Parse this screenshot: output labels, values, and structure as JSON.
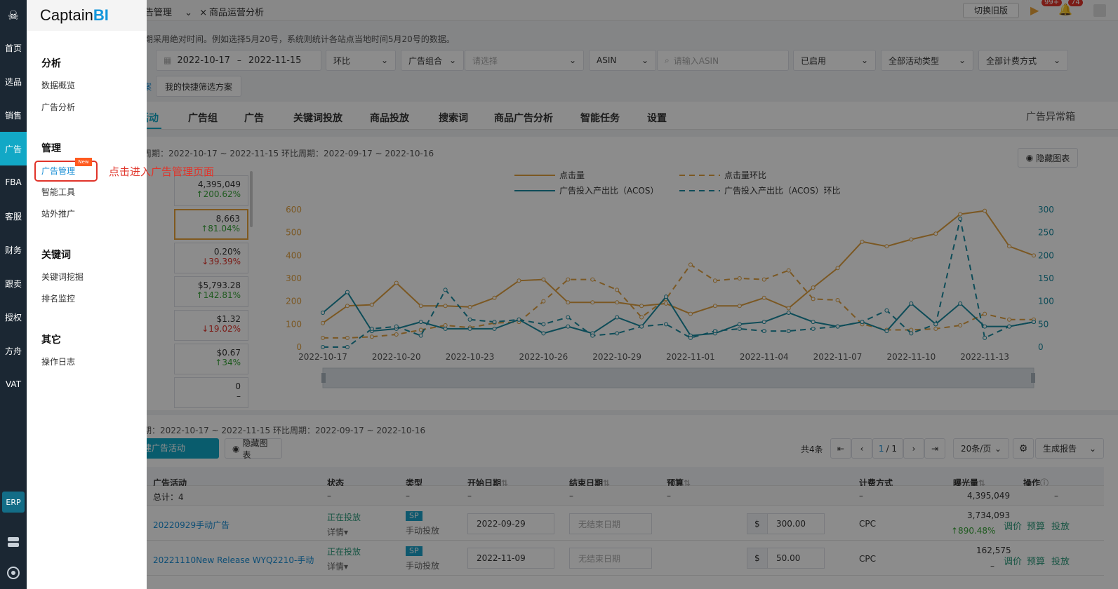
{
  "iconbar": {
    "items": [
      "首页",
      "选品",
      "销售",
      "广告",
      "FBA",
      "客服",
      "财务",
      "跟卖",
      "授权",
      "方舟",
      "VAT"
    ],
    "active": "广告",
    "erp": "ERP"
  },
  "menu": {
    "brand_a": "Captain",
    "brand_b": "BI",
    "sections": [
      {
        "title": "分析",
        "items": [
          "数据概览",
          "广告分析"
        ]
      },
      {
        "title": "管理",
        "items": [
          "广告管理",
          "智能工具",
          "站外推广"
        ]
      },
      {
        "title": "关键词",
        "items": [
          "关键词挖掘",
          "排名监控"
        ]
      },
      {
        "title": "其它",
        "items": [
          "操作日志"
        ]
      }
    ],
    "new_tag": "New",
    "callout": "点击进入广告管理页面"
  },
  "topbar": {
    "tab1": "告管理",
    "tab2": "商品运营分析",
    "switch_old": "切换旧版",
    "badge1": "99+",
    "badge2": "74"
  },
  "notice": "期采用绝对时间。例如选择5月20号，系统则统计各站点当地时间5月20号的数据。",
  "filters": {
    "date_start": "2022-10-17",
    "date_sep": "–",
    "date_end": "2022-11-15",
    "compare": "环比",
    "group": "广告组合",
    "group_ph": "请选择",
    "asin": "ASIN",
    "asin_ph": "请输入ASIN",
    "status": "已启用",
    "activity_type": "全部活动类型",
    "billing": "全部计费方式",
    "quick_left": "案",
    "quick": "我的快捷筛选方案"
  },
  "tabs": [
    "活动",
    "广告组",
    "广告",
    "关键词投放",
    "商品投放",
    "搜索词",
    "商品广告分析",
    "智能任务",
    "设置"
  ],
  "tab_right": "广告异常箱",
  "chart_period": "周期：2022-10-17 ~ 2022-11-15 环比周期：2022-09-17 ~ 2022-10-16",
  "hide_chart": "隐藏图表",
  "metric_cards": [
    {
      "value": "4,395,049",
      "change": "↑200.62%",
      "dir": "up"
    },
    {
      "value": "8,663",
      "change": "↑81.04%",
      "dir": "up"
    },
    {
      "value": "0.20%",
      "change": "↓39.39%",
      "dir": "down"
    },
    {
      "value": "$5,793.28",
      "change": "↑142.81%",
      "dir": "up"
    },
    {
      "value": "$1.32",
      "change": "↓19.02%",
      "dir": "down"
    },
    {
      "value": "$0.67",
      "change": "↑34%",
      "dir": "up"
    },
    {
      "value": "0",
      "change": "–",
      "dir": "none"
    }
  ],
  "chart_data": {
    "type": "line",
    "x": [
      "2022-10-17",
      "2022-10-18",
      "2022-10-19",
      "2022-10-20",
      "2022-10-21",
      "2022-10-22",
      "2022-10-23",
      "2022-10-24",
      "2022-10-25",
      "2022-10-26",
      "2022-10-27",
      "2022-10-28",
      "2022-10-29",
      "2022-10-30",
      "2022-10-31",
      "2022-11-01",
      "2022-11-02",
      "2022-11-03",
      "2022-11-04",
      "2022-11-05",
      "2022-11-06",
      "2022-11-07",
      "2022-11-08",
      "2022-11-09",
      "2022-11-10",
      "2022-11-11",
      "2022-11-12",
      "2022-11-13",
      "2022-11-14",
      "2022-11-15"
    ],
    "xticks": [
      "2022-10-17",
      "2022-10-20",
      "2022-10-23",
      "2022-10-26",
      "2022-10-29",
      "2022-11-01",
      "2022-11-04",
      "2022-11-07",
      "2022-11-10",
      "2022-11-13"
    ],
    "y_left_ticks": [
      0,
      100,
      200,
      300,
      400,
      500,
      600
    ],
    "y_right_ticks": [
      0,
      50,
      100,
      150,
      200,
      250,
      300
    ],
    "ylim_left": [
      0,
      600
    ],
    "ylim_right": [
      0,
      300
    ],
    "legend_placement": "top",
    "series": [
      {
        "name": "点击量",
        "axis": "left",
        "style": "solid",
        "color": "#e0a040",
        "values": [
          105,
          180,
          185,
          280,
          180,
          180,
          175,
          215,
          290,
          295,
          195,
          195,
          195,
          180,
          190,
          145,
          180,
          180,
          215,
          170,
          260,
          345,
          460,
          440,
          470,
          495,
          580,
          595,
          440,
          400
        ]
      },
      {
        "name": "点击量环比",
        "axis": "left",
        "style": "dashed",
        "color": "#e0a040",
        "values": [
          40,
          40,
          45,
          55,
          75,
          95,
          85,
          105,
          110,
          200,
          295,
          295,
          250,
          130,
          210,
          360,
          290,
          300,
          295,
          335,
          210,
          205,
          100,
          75,
          75,
          80,
          95,
          145,
          120,
          120
        ]
      },
      {
        "name": "广告投入产出比（ACOS）",
        "axis": "right",
        "style": "solid",
        "color": "#1a8aa0",
        "values": [
          75,
          120,
          35,
          40,
          55,
          40,
          40,
          40,
          60,
          30,
          45,
          30,
          65,
          45,
          110,
          25,
          30,
          50,
          55,
          75,
          55,
          45,
          55,
          35,
          95,
          50,
          95,
          45,
          45,
          55
        ]
      },
      {
        "name": "广告投入产出比（ACOS）环比",
        "axis": "right",
        "style": "dashed",
        "color": "#1a8aa0",
        "values": [
          0,
          0,
          40,
          45,
          25,
          125,
          60,
          55,
          60,
          50,
          65,
          25,
          30,
          45,
          50,
          20,
          35,
          40,
          35,
          35,
          40,
          45,
          55,
          80,
          30,
          50,
          280,
          20,
          45,
          55
        ]
      }
    ],
    "colors": {
      "clicks": "#e0a040",
      "acos": "#1a8aa0"
    }
  },
  "table_section": {
    "period": "期：2022-10-17 ~ 2022-11-15 环比周期：2022-09-17 ~ 2022-10-16",
    "create": "建广告活动",
    "hide_chart": "隐藏图表",
    "total_count": "共4条",
    "page_current": "1",
    "page_total": "/ 1",
    "page_size": "20条/页",
    "report": "生成报告",
    "headers": [
      "广告活动",
      "状态",
      "类型",
      "开始日期",
      "结束日期",
      "预算",
      "计费方式",
      "曝光量",
      "操作"
    ],
    "total_row": {
      "label": "总计：4",
      "dash": "–",
      "impressions": "4,395,049"
    },
    "rows": [
      {
        "name": "20220929手动广告",
        "status": "正在投放",
        "detail": "详情",
        "type_tag": "SP",
        "type": "手动投放",
        "start": "2022-09-29",
        "end_ph": "无结束日期",
        "currency": "$",
        "budget": "300.00",
        "billing": "CPC",
        "impressions": "3,734,093",
        "imp_change": "↑890.48%",
        "act1": "调价",
        "act2": "预算",
        "act3": "投放"
      },
      {
        "name": "20221110New Release WYQ2210-手动",
        "status": "正在投放",
        "detail": "详情",
        "type_tag": "SP",
        "type": "手动投放",
        "start": "2022-11-09",
        "end_ph": "无结束日期",
        "currency": "$",
        "budget": "50.00",
        "billing": "CPC",
        "impressions": "162,575",
        "imp_change": "–",
        "act1": "调价",
        "act2": "预算",
        "act3": "投放"
      }
    ]
  }
}
